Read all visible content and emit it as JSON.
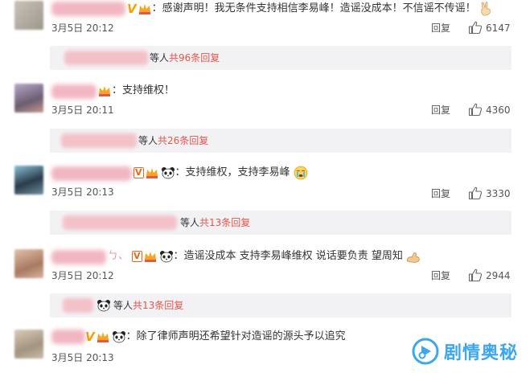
{
  "comments": [
    {
      "text": "：感谢声明！我无条件支持相信李易峰！造谣没成本！不信谣不传谣！",
      "time": "3月5日 20:12",
      "reply": "回复",
      "likes": "6147",
      "subreplies": {
        "suffix": "等人",
        "more": "共96条回复"
      }
    },
    {
      "text": "：支持维权！",
      "time": "3月5日 20:11",
      "reply": "回复",
      "likes": "4360",
      "subreplies": {
        "suffix": "等人",
        "more": "共26条回复"
      }
    },
    {
      "text": "：支持维权，支持李易峰",
      "time": "3月5日 20:13",
      "reply": "回复",
      "likes": "3330",
      "subreplies": {
        "suffix": "等人",
        "more": "共13条回复"
      }
    },
    {
      "name_tail": "ㄅ、",
      "text": "：造谣没成本 支持李易峰维权 说话要负责 望周知",
      "time": "3月5日 20:12",
      "reply": "回复",
      "likes": "2944",
      "subreplies": {
        "suffix": "等人",
        "more": "共13条回复"
      }
    },
    {
      "text": "：除了律师声明还希望针对造谣的源头予以追究",
      "time": "3月5日 20:13"
    }
  ],
  "badges": {
    "v": "V"
  },
  "watermark": {
    "text": "剧情奥秘"
  },
  "colors": {
    "accent_red": "#e8544c",
    "sub_bg": "#f2f2f5",
    "watermark_blue": "#3da7ee"
  }
}
